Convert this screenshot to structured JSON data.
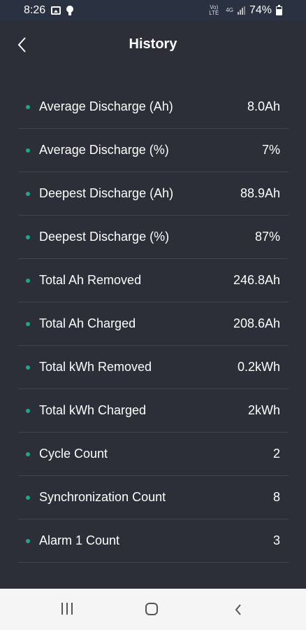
{
  "status_bar": {
    "time": "8:26",
    "network_text": "4G",
    "volte_text": "Vo) LTE",
    "battery_percent": "74%",
    "icons": [
      "image-icon",
      "bulb-icon",
      "volte-icon",
      "signal-icon",
      "battery-icon"
    ]
  },
  "header": {
    "title": "History",
    "back_icon": "chevron-left-icon"
  },
  "rows": [
    {
      "label": "Average Discharge (Ah)",
      "value": "8.0Ah"
    },
    {
      "label": "Average Discharge (%)",
      "value": "7%"
    },
    {
      "label": "Deepest Discharge (Ah)",
      "value": "88.9Ah"
    },
    {
      "label": "Deepest Discharge (%)",
      "value": "87%"
    },
    {
      "label": "Total Ah Removed",
      "value": "246.8Ah"
    },
    {
      "label": "Total Ah Charged",
      "value": "208.6Ah"
    },
    {
      "label": "Total kWh Removed",
      "value": "0.2kWh"
    },
    {
      "label": "Total kWh Charged",
      "value": "2kWh"
    },
    {
      "label": "Cycle Count",
      "value": "2"
    },
    {
      "label": "Synchronization Count",
      "value": "8"
    },
    {
      "label": "Alarm 1 Count",
      "value": "3"
    }
  ],
  "colors": {
    "background": "#2c2f38",
    "bullet": "#1fa58a",
    "status_bar": "#2a3140",
    "nav_bar": "#f5f5f5"
  },
  "nav_bar": {
    "icons": [
      "recent-apps-icon",
      "home-icon",
      "back-icon"
    ]
  }
}
